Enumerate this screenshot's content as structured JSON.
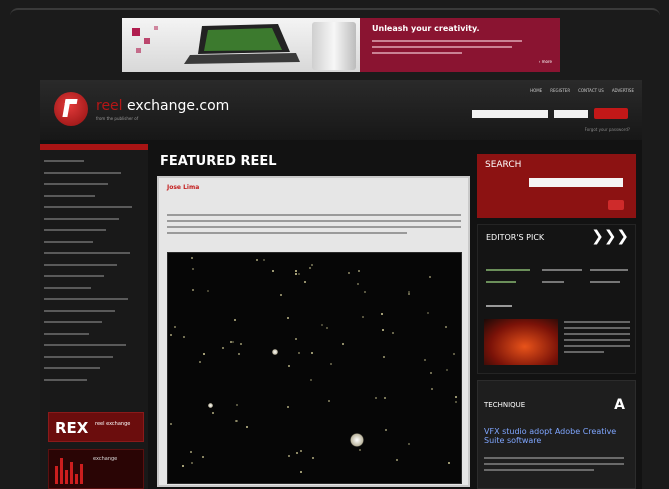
{
  "ad": {
    "headline": "Unleash your creativity.",
    "more": "› more"
  },
  "header": {
    "logo_prefix": "reel",
    "logo_main": "exchange.com",
    "tagline": "from the publisher of",
    "topnav": [
      "HOME",
      "REGISTER",
      "CONTACT US",
      "ADVERTISE"
    ],
    "forgot": "Forgot your password?"
  },
  "leftnav": {
    "items": [
      "",
      "",
      "",
      "",
      "",
      "",
      "",
      "",
      "",
      "",
      "",
      "",
      "",
      "",
      "",
      "",
      "",
      "",
      "",
      ""
    ]
  },
  "rex": {
    "big": "REX",
    "small": "reel exchange",
    "small2": "exchange"
  },
  "main": {
    "title": "FEATURED REEL",
    "author": "Jose Lima",
    "date": "",
    "tag": "",
    "genre": ""
  },
  "search": {
    "title": "SEARCH",
    "label": "",
    "advanced": ""
  },
  "editors_pick": {
    "title": "EDITOR'S PICK",
    "arrows": "❯❯❯"
  },
  "technique": {
    "title": "TECHNIQUE",
    "logo": "A",
    "article": "VFX studio adopt Adobe Creative Suite software"
  },
  "colors": {
    "brand_red": "#b51616",
    "link_blue": "#7fa6ff"
  }
}
